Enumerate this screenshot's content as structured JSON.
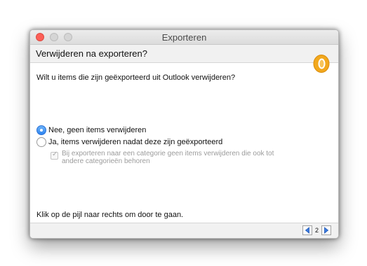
{
  "window": {
    "title": "Exporteren"
  },
  "header": {
    "title": "Verwijderen na exporteren?",
    "logo_icon": "outlook-logo-icon"
  },
  "main": {
    "question": "Wilt u items die zijn geëxporteerd uit Outlook verwijderen?",
    "options": [
      {
        "label": "Nee, geen items verwijderen",
        "selected": true
      },
      {
        "label": "Ja, items verwijderen nadat deze zijn geëxporteerd",
        "selected": false
      }
    ],
    "sub_option": {
      "label": "Bij exporteren naar een categorie geen items verwijderen die ook tot andere categorieën behoren",
      "checked": true,
      "enabled": false
    },
    "instruction": "Klik op de pijl naar rechts om door te gaan."
  },
  "footer": {
    "page_number": "2",
    "prev_icon": "arrow-left-icon",
    "next_icon": "arrow-right-icon"
  },
  "colors": {
    "accent_blue": "#2e84f0",
    "close_red": "#fc5f57",
    "logo_orange": "#f5a623"
  }
}
